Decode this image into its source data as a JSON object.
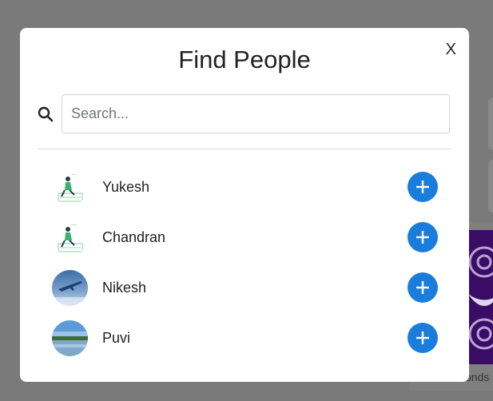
{
  "modal": {
    "title": "Find People",
    "close_label": "X"
  },
  "search": {
    "placeholder": "Search...",
    "value": ""
  },
  "people": [
    {
      "name": "Yukesh",
      "avatar": "illustration-person-icon"
    },
    {
      "name": "Chandran",
      "avatar": "illustration-person-icon"
    },
    {
      "name": "Nikesh",
      "avatar": "airplane-sky-photo"
    },
    {
      "name": "Puvi",
      "avatar": "lake-landscape-photo"
    }
  ],
  "background": {
    "caption_fragment": "onds"
  },
  "colors": {
    "accent": "#1b7ddb",
    "overlay": "#7a7a7a"
  }
}
